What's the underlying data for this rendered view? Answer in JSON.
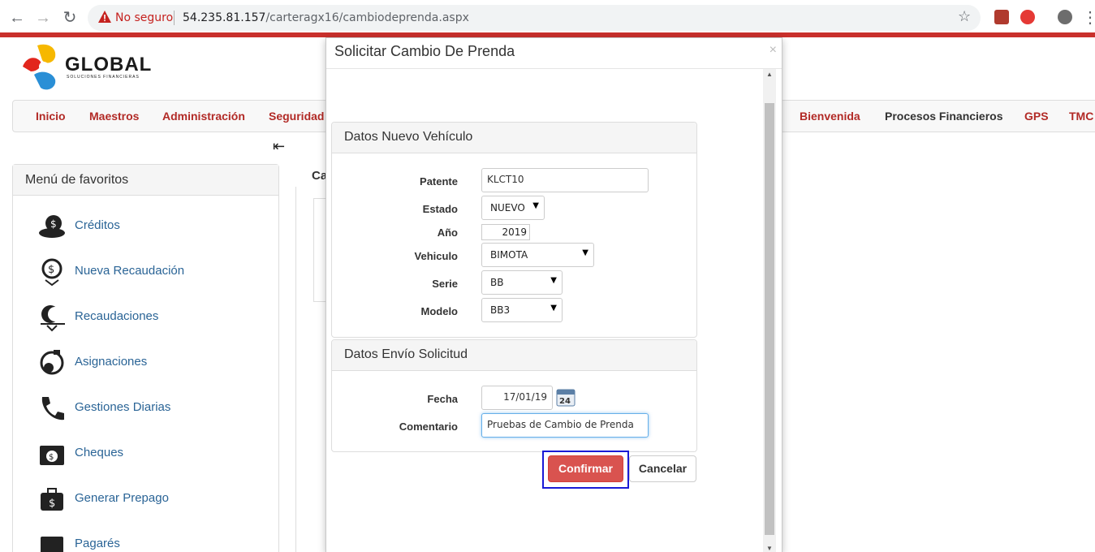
{
  "browser": {
    "security_label": "No seguro",
    "url_host": "54.235.81.157",
    "url_path": "/carteragx16/cambiodeprenda.aspx"
  },
  "app": {
    "logo_text": "GLOBAL",
    "logo_subtitle": "SOLUCIONES FINANCIERAS",
    "menu": {
      "inicio": "Inicio",
      "maestros": "Maestros",
      "administracion": "Administración",
      "seguridad": "Seguridad",
      "bienvenida": "Bienvenida",
      "procesos": "Procesos Financieros",
      "gps": "GPS",
      "tmc": "TMC"
    },
    "collapse_glyph": "⇤",
    "favorites": {
      "title": "Menú de favoritos",
      "items": [
        {
          "label": "Créditos",
          "icon": "credit-icon"
        },
        {
          "label": "Nueva Recaudación",
          "icon": "new-collection-icon"
        },
        {
          "label": "Recaudaciones",
          "icon": "collections-icon"
        },
        {
          "label": "Asignaciones",
          "icon": "assignments-icon"
        },
        {
          "label": "Gestiones Diarias",
          "icon": "phone-icon"
        },
        {
          "label": "Cheques",
          "icon": "checks-icon"
        },
        {
          "label": "Generar Prepago",
          "icon": "prepay-icon"
        },
        {
          "label": "Pagarés",
          "icon": "promissory-icon"
        }
      ]
    },
    "background_title": "Ca"
  },
  "modal": {
    "title": "Solicitar Cambio De Prenda",
    "close_glyph": "×",
    "vehicle_section": {
      "title": "Datos Nuevo Vehículo",
      "patente_label": "Patente",
      "patente_value": "KLCT10",
      "estado_label": "Estado",
      "estado_value": "NUEVO",
      "anio_label": "Año",
      "anio_value": "2019",
      "vehiculo_label": "Vehiculo",
      "vehiculo_value": "BIMOTA",
      "serie_label": "Serie",
      "serie_value": "BB",
      "modelo_label": "Modelo",
      "modelo_value": "BB3"
    },
    "request_section": {
      "title": "Datos Envío Solicitud",
      "fecha_label": "Fecha",
      "fecha_value": "17/01/19",
      "calendar_day": "24",
      "comentario_label": "Comentario",
      "comentario_value": "Pruebas de Cambio de Prenda"
    },
    "confirm_label": "Confirmar",
    "cancel_label": "Cancelar"
  },
  "colors": {
    "brand_red": "#b22a26",
    "confirm_red": "#d9534f",
    "link_blue": "#2a6496",
    "highlight_blue": "#1a1ad6"
  }
}
